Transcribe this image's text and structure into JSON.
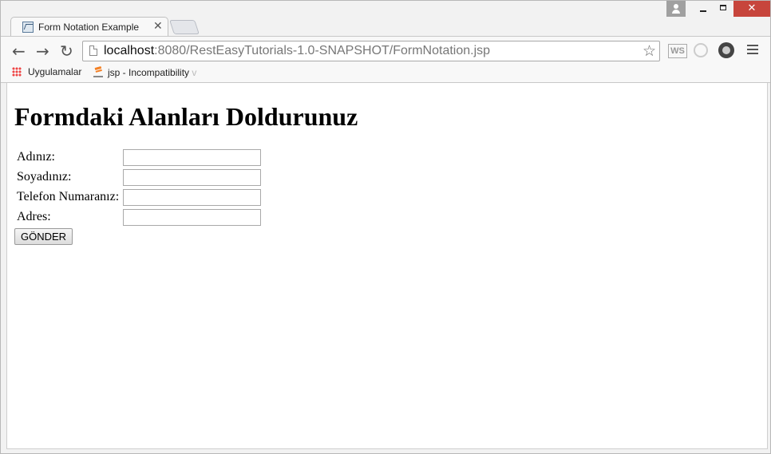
{
  "browser": {
    "tab": {
      "title": "Form Notation Example",
      "close": "✕"
    },
    "window_controls": {
      "close": "✕"
    },
    "address_bar": {
      "host": "localhost",
      "path": ":8080/RestEasyTutorials-1.0-SNAPSHOT/FormNotation.jsp"
    },
    "nav": {
      "back": "←",
      "forward": "→",
      "reload": "↻",
      "star": "☆"
    },
    "extensions": {
      "ws": "WS"
    },
    "bookmarks": [
      {
        "label": "Uygulamalar"
      },
      {
        "label": "jsp - Incompatibility",
        "fade": " v"
      }
    ]
  },
  "page": {
    "heading": "Formdaki Alanları Doldurunuz",
    "fields": [
      {
        "label": "Adınız:",
        "value": ""
      },
      {
        "label": "Soyadınız:",
        "value": ""
      },
      {
        "label": "Telefon Numaranız:",
        "value": ""
      },
      {
        "label": "Adres:",
        "value": ""
      }
    ],
    "submit_label": "GÖNDER"
  }
}
